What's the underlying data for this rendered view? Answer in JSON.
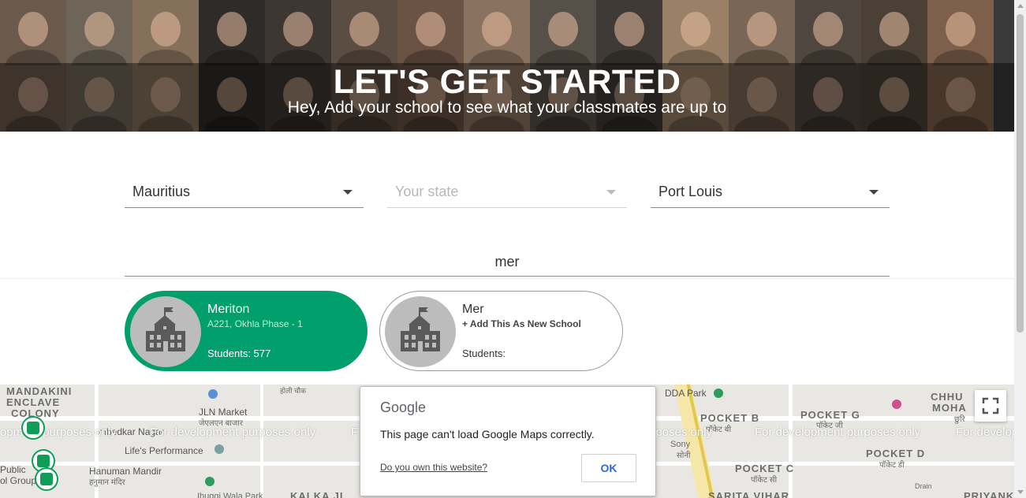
{
  "hero": {
    "title": "LET'S GET STARTED",
    "subtitle": "Hey, Add your school to see what your classmates are up to"
  },
  "form": {
    "country": {
      "value": "Mauritius"
    },
    "state": {
      "placeholder": "Your state"
    },
    "city": {
      "value": "Port Louis"
    },
    "school_search": {
      "value": "mer"
    }
  },
  "results": [
    {
      "name_match": "Mer",
      "name_rest": "iton",
      "address": "A221, Okhla Phase - 1",
      "students": "Students: 577",
      "icon": "school-building-icon",
      "selected": true
    },
    {
      "name_match": "Mer",
      "name_rest": "",
      "action": "+ Add This As New School",
      "students": "Students:",
      "icon": "school-building-icon",
      "selected": false
    }
  ],
  "map": {
    "labels": [
      "MANDAKINI",
      "ENCLAVE",
      "COLONY",
      "JLN Market",
      "जेएलएन बाजार",
      "Life's Performance",
      "Hanuman Mandir",
      "हनुमान मंदिर",
      "होली चौक",
      "DDA Park",
      "POCKET B",
      "पॉकेट बी",
      "POCKET G",
      "पॉकेट जी",
      "POCKET D",
      "पॉकेट डी",
      "POCKET C",
      "पॉकेट सी",
      "CHHU",
      "MOHA",
      "छुरि",
      "Sony",
      "सोनी",
      "KALKA JI",
      "SARITA VIHAR",
      "Public",
      "ol Group",
      "mbedkar Nagar",
      "Ihuggi Wala Park",
      "Drain",
      "PRIYANK"
    ],
    "dev_watermark": "For development purposes only",
    "dev_watermark_partial_left": "opment purposes only",
    "dev_watermark_partial_mid": "urposes only",
    "dev_watermark_partial_right": "For develop",
    "dev_watermark_partial_f": "F"
  },
  "dialog": {
    "brand": "Google",
    "message": "This page can't load Google Maps correctly.",
    "link": "Do you own this website?",
    "ok": "OK"
  }
}
